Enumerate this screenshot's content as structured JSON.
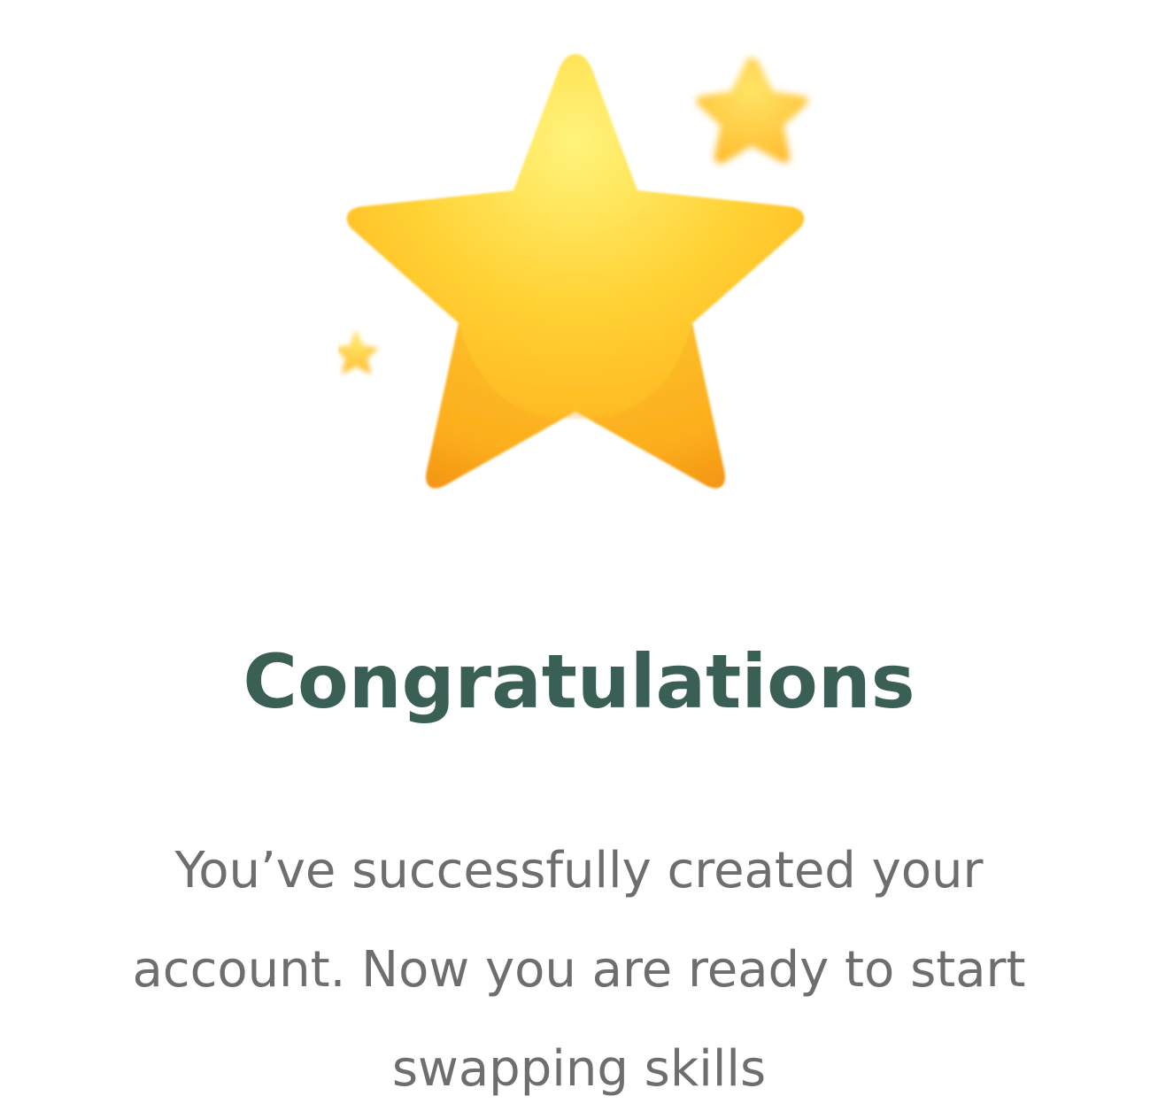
{
  "success_screen": {
    "title": "Congratulations",
    "message_lines": [
      "You’ve successfully created your",
      "account. Now you are ready to start",
      "swapping skills"
    ],
    "illustration": "stars-icon",
    "colors": {
      "title": "#3a5f54",
      "message": "#6e6e6e",
      "star_light": "#fff27a",
      "star_main": "#ffc42e",
      "star_dark": "#f49a14"
    }
  }
}
